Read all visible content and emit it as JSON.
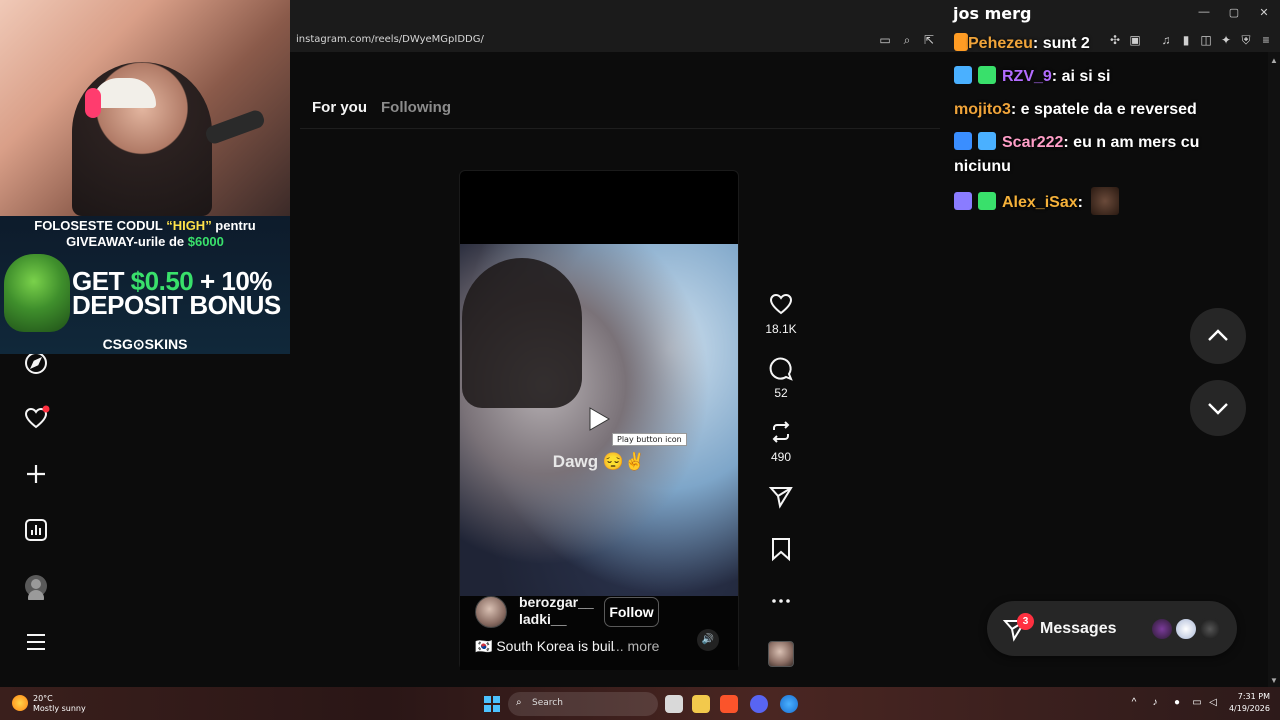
{
  "browser": {
    "window_title": "jos merg",
    "url": "instagram.com/reels/DWyeMGpIDDG/",
    "window_controls": [
      "—",
      "▢",
      "✕"
    ]
  },
  "stream_overlay": {
    "promo_line1_pre": "FOLOSESTE CODUL ",
    "promo_line1_code": "“HIGH”",
    "promo_line1_post": " pentru",
    "promo_line2_pre": "GIVEAWAY-urile de ",
    "promo_line2_amount": "$6000",
    "promo_big1_pre": "GET ",
    "promo_big1_amount": "$0.50",
    "promo_big1_post": " + 10%",
    "promo_big2": "DEPOSIT BONUS",
    "promo_brand": "CSG⊙SKINS"
  },
  "feed": {
    "tabs": [
      {
        "label": "For you",
        "active": true
      },
      {
        "label": "Following",
        "active": false
      }
    ]
  },
  "reel": {
    "overlay_text": "Dawg 😔✌",
    "tooltip": "Play button icon",
    "username": "berozgar__ ladki__",
    "follow_label": "Follow",
    "description": "🇰🇷 South Korea is buil",
    "more_label": "... more"
  },
  "actions": {
    "likes": "18.1K",
    "comments": "52",
    "reposts": "490"
  },
  "messages": {
    "label": "Messages",
    "badge": "3"
  },
  "chat": [
    {
      "user": "Pehezeu",
      "message": "sunt 2",
      "color": "#f0a43a"
    },
    {
      "user": "RZV_9",
      "message": "ai si si",
      "color": "#b36cff"
    },
    {
      "user": "mojito3",
      "message": "e spatele da e reversed",
      "color": "#f0a43a"
    },
    {
      "user": "Scar222",
      "message": "eu n am mers cu niciunu",
      "color": "#ff9ec7"
    },
    {
      "user": "Alex_iSax",
      "message": "",
      "color": "#f5b13a"
    }
  ],
  "taskbar": {
    "weather_temp": "20°C",
    "weather_condition": "Mostly sunny",
    "search_label": "Search",
    "time": "7:31 PM",
    "date": "4/19/2026"
  },
  "colors": {
    "accent_red": "#ff3040",
    "chat_orange": "#f0a43a",
    "chat_purple": "#b36cff",
    "promo_green": "#39e06b",
    "promo_yellow": "#ffe24a"
  }
}
